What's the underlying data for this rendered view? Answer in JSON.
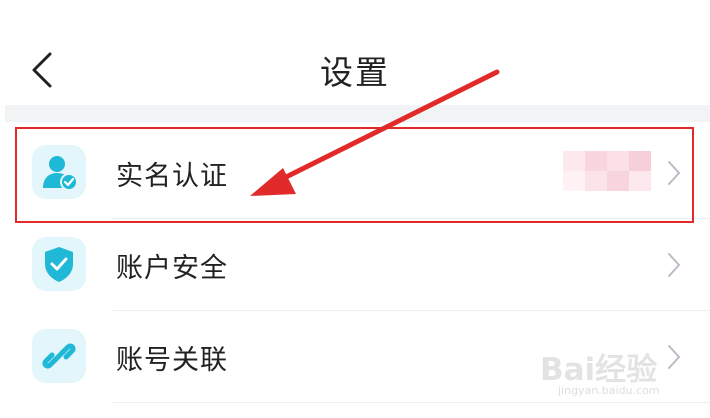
{
  "header": {
    "title": "设置",
    "back_icon": "chevron-left-icon"
  },
  "settings": {
    "items": [
      {
        "label": "实名认证",
        "icon": "user-verified-icon",
        "value_blurred": true
      },
      {
        "label": "账户安全",
        "icon": "shield-check-icon"
      },
      {
        "label": "账号关联",
        "icon": "link-icon"
      }
    ]
  },
  "annotation": {
    "highlight_color": "#e12b2b"
  },
  "watermark": {
    "logo": "Bai经验",
    "url": "jingyan.baidu.com"
  },
  "colors": {
    "icon_accent": "#1fb8d6",
    "icon_bg": "#e3f6fb"
  }
}
